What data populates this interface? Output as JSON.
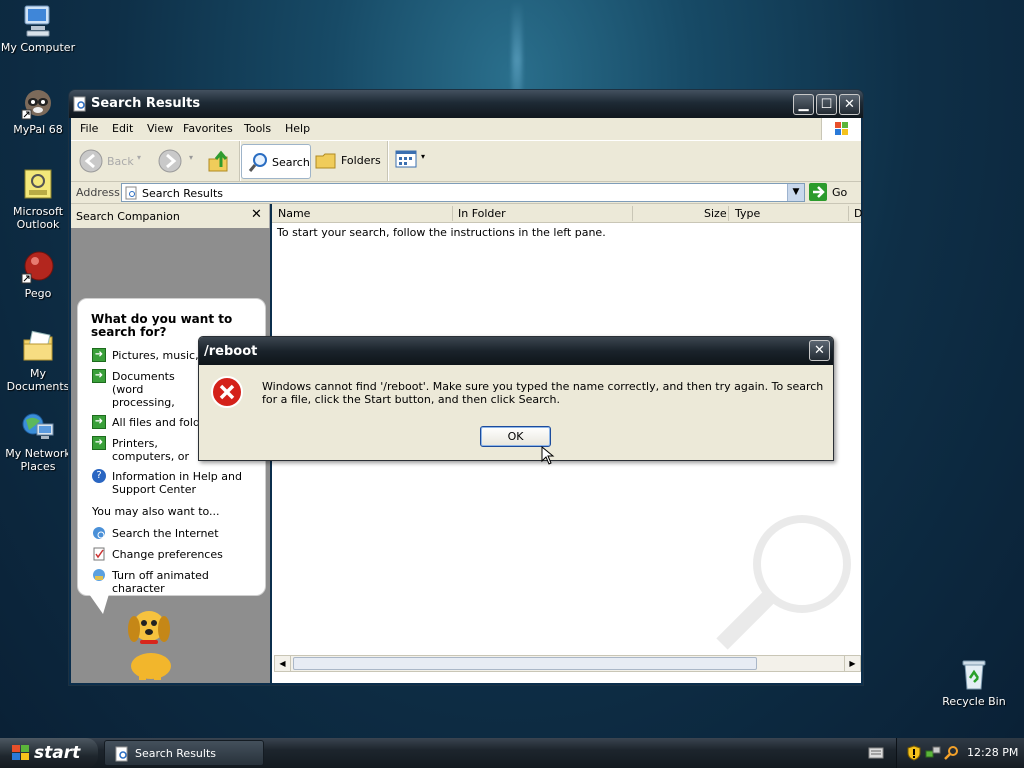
{
  "desktop": {
    "icons": [
      {
        "label": "My Computer",
        "icon": "computer-icon"
      },
      {
        "label": "MyPal 68",
        "icon": "raccoon-icon"
      },
      {
        "label": "Microsoft Outlook",
        "icon": "outlook-icon"
      },
      {
        "label": "Pego",
        "icon": "pego-icon"
      },
      {
        "label": "My Documents",
        "icon": "folder-icon"
      },
      {
        "label": "My Network Places",
        "icon": "network-icon"
      },
      {
        "label": "Recycle Bin",
        "icon": "recycle-bin-icon"
      }
    ]
  },
  "window": {
    "title": "Search Results",
    "menu": [
      "File",
      "Edit",
      "View",
      "Favorites",
      "Tools",
      "Help"
    ],
    "toolbar": {
      "back": "Back",
      "search": "Search",
      "folders": "Folders"
    },
    "address": {
      "label": "Address",
      "value": "Search Results",
      "go": "Go"
    },
    "search_companion": {
      "title": "Search Companion",
      "question": "What do you want to search for?",
      "options": [
        "Pictures, music, or video",
        "Documents (word processing, spreadsheet, etc.)",
        "All files and folders",
        "Printers, computers, or people",
        "Information in Help and Support Center"
      ],
      "also_label": "You may also want to...",
      "also": [
        "Search the Internet",
        "Change preferences",
        "Turn off animated character"
      ]
    },
    "columns": [
      "Name",
      "In Folder",
      "Size",
      "Type",
      "D"
    ],
    "empty_message": "To start your search, follow the instructions in the left pane."
  },
  "dialog": {
    "title": "/reboot",
    "message": "Windows cannot find '/reboot'. Make sure you typed the name correctly, and then try again. To search for a file, click the Start button, and then click Search.",
    "ok": "OK"
  },
  "taskbar": {
    "start": "start",
    "task": "Search Results",
    "clock": "12:28 PM"
  },
  "colors": {
    "error_red": "#d4211a",
    "go_green": "#2c9b2c"
  }
}
